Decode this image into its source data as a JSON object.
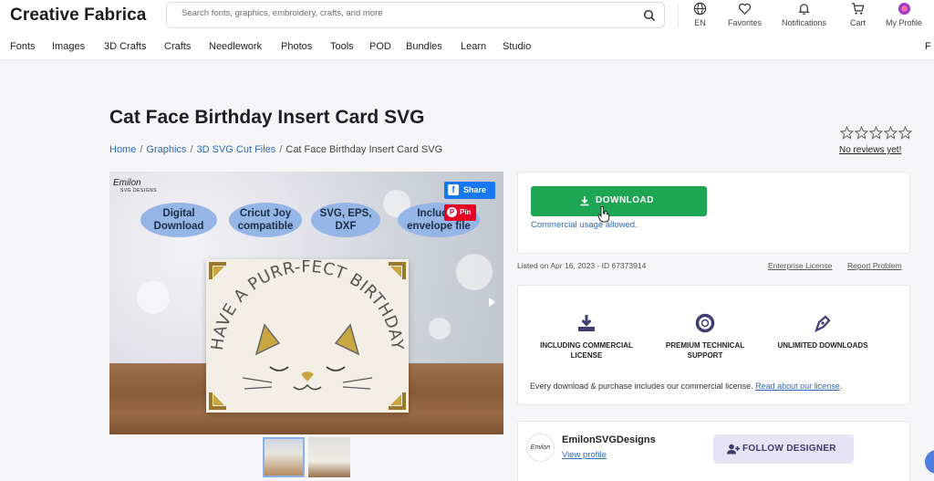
{
  "header": {
    "logo": "Creative Fabrica",
    "search_placeholder": "Search fonts, graphics, embroidery, crafts, and more",
    "items": [
      {
        "label": "EN",
        "icon": "globe-icon"
      },
      {
        "label": "Favorites",
        "icon": "heart-icon"
      },
      {
        "label": "Notifications",
        "icon": "bell-icon"
      },
      {
        "label": "Cart",
        "icon": "cart-icon"
      },
      {
        "label": "My Profile",
        "icon": "avatar"
      }
    ]
  },
  "nav": [
    "Fonts",
    "Images",
    "3D Crafts",
    "Crafts",
    "Needlework",
    "Photos",
    "Tools",
    "POD",
    "Bundles",
    "Learn",
    "Studio"
  ],
  "nav_overflow": "F",
  "product": {
    "title": "Cat Face Birthday Insert Card SVG",
    "breadcrumb": [
      "Home",
      "Graphics",
      "3D SVG Cut Files",
      "Cat Face Birthday Insert Card SVG"
    ],
    "breadcrumb_sep": "/",
    "reviews": "No reviews yet!",
    "rating": 0,
    "rating_max": 5
  },
  "image": {
    "brand_line1": "Emilon",
    "brand_line2": "SVG DESIGNS",
    "pills": [
      "Digital Download",
      "Cricut Joy compatible",
      "SVG, EPS, DXF",
      "Included envelope file"
    ],
    "card_text": "HAVE A PURR-FECT BIRTHDAY",
    "share_label": "Share",
    "pin_label": "Pin"
  },
  "purchase": {
    "download_label": "DOWNLOAD",
    "commercial_note": "Commercial usage allowed.",
    "listed": "Listed on Apr 16, 2023 - ID 67373914",
    "enterprise": "Enterprise License",
    "report": "Report Problem"
  },
  "features": [
    {
      "label": "INCLUDING COMMERCIAL LICENSE",
      "icon": "download-tray-icon"
    },
    {
      "label": "PREMIUM TECHNICAL SUPPORT",
      "icon": "lifebuoy-icon"
    },
    {
      "label": "UNLIMITED DOWNLOADS",
      "icon": "pen-nib-icon"
    }
  ],
  "license_note": "Every download & purchase includes our commercial license.",
  "license_link": "Read about our license",
  "license_end": ".",
  "designer": {
    "name": "EmilonSVGDesigns",
    "view_profile": "View profile",
    "avatar_text": "Emilon",
    "follow_label": "FOLLOW DESIGNER"
  },
  "colors": {
    "download": "#1ea654",
    "link": "#2f6bb8",
    "follow_bg": "#e7e4f7",
    "facebook": "#1877f2",
    "pinterest": "#e60023"
  }
}
